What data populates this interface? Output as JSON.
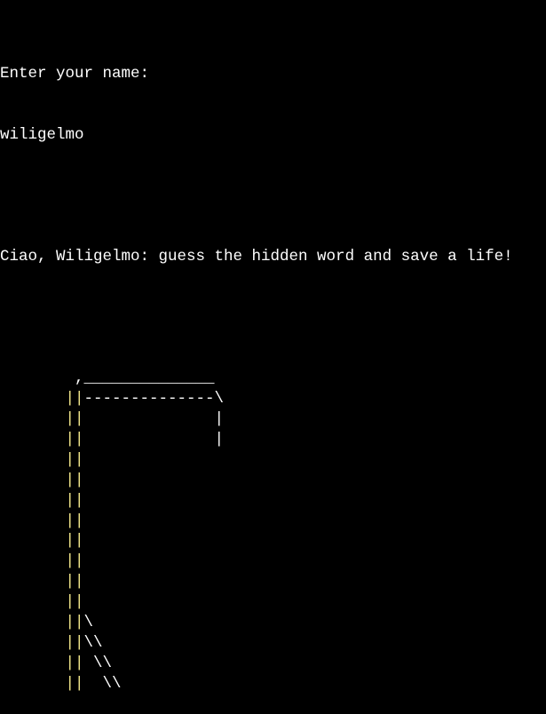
{
  "console": {
    "prompt": "Enter your name:",
    "input_value": "wiligelmo",
    "greeting": "Ciao, Wiligelmo: guess the hidden word and save a life!"
  },
  "colors": {
    "background": "#000000",
    "text": "#ffffff",
    "pole": "#f4e98c"
  },
  "hangman_art": [
    [
      {
        "t": "        ,______________",
        "c": "text"
      }
    ],
    [
      {
        "t": "       ",
        "c": "text"
      },
      {
        "t": "||",
        "c": "pole"
      },
      {
        "t": "--------------\\",
        "c": "text"
      }
    ],
    [
      {
        "t": "       ",
        "c": "text"
      },
      {
        "t": "||",
        "c": "pole"
      },
      {
        "t": "              |",
        "c": "text"
      }
    ],
    [
      {
        "t": "       ",
        "c": "text"
      },
      {
        "t": "||",
        "c": "pole"
      },
      {
        "t": "              |",
        "c": "text"
      }
    ],
    [
      {
        "t": "       ",
        "c": "text"
      },
      {
        "t": "||",
        "c": "pole"
      }
    ],
    [
      {
        "t": "       ",
        "c": "text"
      },
      {
        "t": "||",
        "c": "pole"
      }
    ],
    [
      {
        "t": "       ",
        "c": "text"
      },
      {
        "t": "||",
        "c": "pole"
      }
    ],
    [
      {
        "t": "       ",
        "c": "text"
      },
      {
        "t": "||",
        "c": "pole"
      }
    ],
    [
      {
        "t": "       ",
        "c": "text"
      },
      {
        "t": "||",
        "c": "pole"
      }
    ],
    [
      {
        "t": "       ",
        "c": "text"
      },
      {
        "t": "||",
        "c": "pole"
      }
    ],
    [
      {
        "t": "       ",
        "c": "text"
      },
      {
        "t": "||",
        "c": "pole"
      }
    ],
    [
      {
        "t": "       ",
        "c": "text"
      },
      {
        "t": "||",
        "c": "pole"
      }
    ],
    [
      {
        "t": "       ",
        "c": "text"
      },
      {
        "t": "||",
        "c": "pole"
      },
      {
        "t": "\\",
        "c": "text"
      }
    ],
    [
      {
        "t": "       ",
        "c": "text"
      },
      {
        "t": "||",
        "c": "pole"
      },
      {
        "t": "\\\\",
        "c": "text"
      }
    ],
    [
      {
        "t": "       ",
        "c": "text"
      },
      {
        "t": "||",
        "c": "pole"
      },
      {
        "t": " \\\\",
        "c": "text"
      }
    ],
    [
      {
        "t": "       ",
        "c": "text"
      },
      {
        "t": "||",
        "c": "pole"
      },
      {
        "t": "  \\\\",
        "c": "text"
      }
    ]
  ]
}
